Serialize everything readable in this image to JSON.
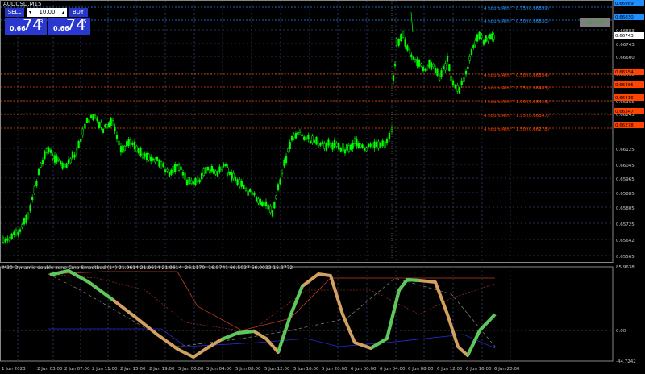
{
  "window": {
    "symbol": "AUDUSD,M15"
  },
  "trade_panel": {
    "sell_label": "SELL",
    "buy_label": "BUY",
    "lot": "10.00",
    "sell_small": "0.66",
    "sell_big": "74",
    "sell_sup": "3",
    "buy_small": "0.66",
    "buy_big": "74",
    "buy_sup": "5"
  },
  "alert_button": "Aft-off",
  "price_axis": [
    "0.66883",
    "0.66743",
    "0.66600",
    "0.66465",
    "0.66365",
    "0.66245",
    "0.66125",
    "0.66045",
    "0.65965",
    "0.65885",
    "0.65805",
    "0.65725",
    "0.65642",
    "0.65565"
  ],
  "price_marker_boxes": [
    {
      "label": "0.66989",
      "color": "#1e90ff"
    },
    {
      "label": "0.66830",
      "color": "#1e90ff"
    },
    {
      "label": "0.66554",
      "color": "#ff4500"
    },
    {
      "label": "0.66485",
      "color": "#ff4500"
    },
    {
      "label": "0.66416",
      "color": "#ff4500"
    },
    {
      "label": "0.66347",
      "color": "#ff4500"
    },
    {
      "label": "0.66278",
      "color": "#ff4500"
    }
  ],
  "fib_levels": [
    {
      "label": "4 hours Ath ^ 0.75 (0.66899)",
      "color": "#1e90ff"
    },
    {
      "label": "4 hours Ath ^ 0.50 (0.66830)",
      "color": "#1e90ff"
    },
    {
      "label": "4 hours Ath ^ 0.50 (0.66554)",
      "color": "#ff4500"
    },
    {
      "label": "4 hours Ath ^ 0.75 (0.66485)",
      "color": "#ff4500"
    },
    {
      "label": "4 hours Ath ^ 1.00 (0.66416)",
      "color": "#ff4500"
    },
    {
      "label": "4 hours Ath ^ 1.25 (0.66347)",
      "color": "#ff4500"
    },
    {
      "label": "4 hours Ath ^ 1.50 (0.66278)",
      "color": "#ff4500"
    }
  ],
  "indicator": {
    "label": "M30 Dynamic double zone Cmo Smoothed (14) 21.9614 21.9614 21.9614 -26.1170 -16.5741 66.5037 56.0033 15.3772",
    "scale": [
      "85.9638",
      "0.00",
      "-44.7242"
    ]
  },
  "time_axis": [
    "1 Jun 2023",
    "2 Jun 03:00",
    "2 Jun 07:00",
    "2 Jun 11:00",
    "2 Jun 15:00",
    "2 Jun 19:00",
    "5 Jun 00:00",
    "5 Jun 04:00",
    "5 Jun 08:00",
    "5 Jun 12:00",
    "5 Jun 16:00",
    "5 Jun 20:00",
    "6 Jun 00:00",
    "6 Jun 04:00",
    "6 Jun 08:00",
    "6 Jun 12:00",
    "6 Jun 16:00",
    "6 Jun 20:00"
  ],
  "colors": {
    "candle": "#00ff00",
    "background": "#000000",
    "grid": "#334",
    "osc_up": "#5ac85a",
    "osc_down": "#d2a060"
  }
}
